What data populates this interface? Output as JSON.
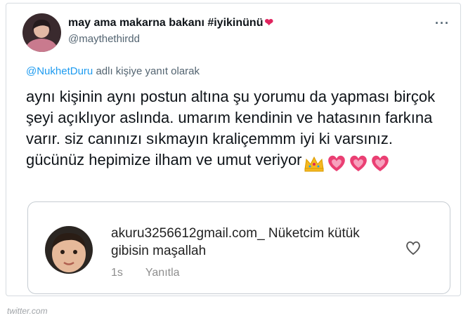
{
  "tweet": {
    "display_name": "may ama makarna bakanı #iyikinünü",
    "handle": "@maythethirdd",
    "reply_mention": "@NukhetDuru",
    "reply_suffix": " adlı kişiye yanıt olarak",
    "body": "aynı kişinin aynı postun altına şu yorumu da yapması birçok şeyi açıklıyor aslında. umarım kendinin ve hatasının farkına varır. siz canınızı sıkmayın kraliçemmm iyi ki varsınız. gücünüz hepimize ilham ve umut veriyor",
    "more_label": "···"
  },
  "comment": {
    "username": "akuru3256612gmail.com_",
    "text": " Nüketcim kütük gibisin maşallah",
    "time": "1s",
    "reply_label": "Yanıtla"
  },
  "watermark": "twitter.com",
  "icons": [
    "heart-emoji",
    "crown-emoji",
    "heart-outline-icon",
    "more-icon"
  ],
  "colors": {
    "link": "#1d9bf0",
    "heart": "#e0245e"
  }
}
